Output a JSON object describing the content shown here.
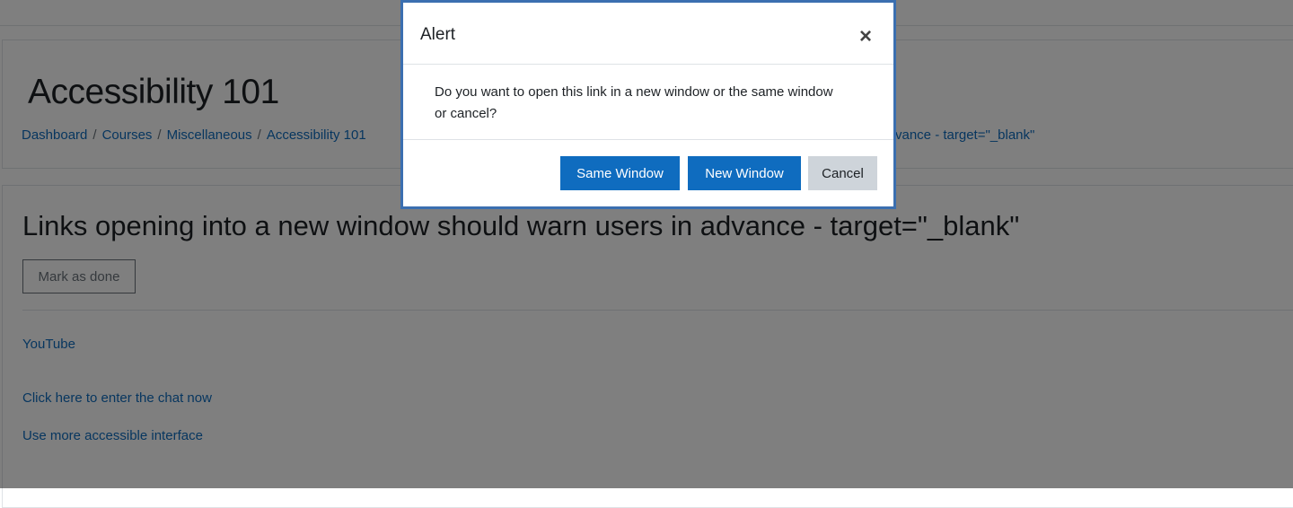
{
  "page": {
    "course_title": "Accessibility 101",
    "breadcrumb": [
      "Dashboard",
      "Courses",
      "Miscellaneous",
      "Accessibility 101"
    ],
    "breadcrumb_tail": "vance - target=\"_blank\"",
    "heading": "Links opening into a new window should warn users in advance - target=\"_blank\"",
    "mark_done_label": "Mark as done",
    "links": [
      "YouTube",
      "Click here to enter the chat now",
      "Use more accessible interface"
    ]
  },
  "dialog": {
    "title": "Alert",
    "close_symbol": "×",
    "message": "Do you want to open this link in a new window or the same window or cancel?",
    "buttons": {
      "same_window": "Same Window",
      "new_window": "New Window",
      "cancel": "Cancel"
    }
  },
  "colors": {
    "link": "#0f6cbf",
    "primary_button": "#0f6cbf",
    "secondary_button": "#ced4da",
    "modal_border": "#3b6fb0"
  }
}
